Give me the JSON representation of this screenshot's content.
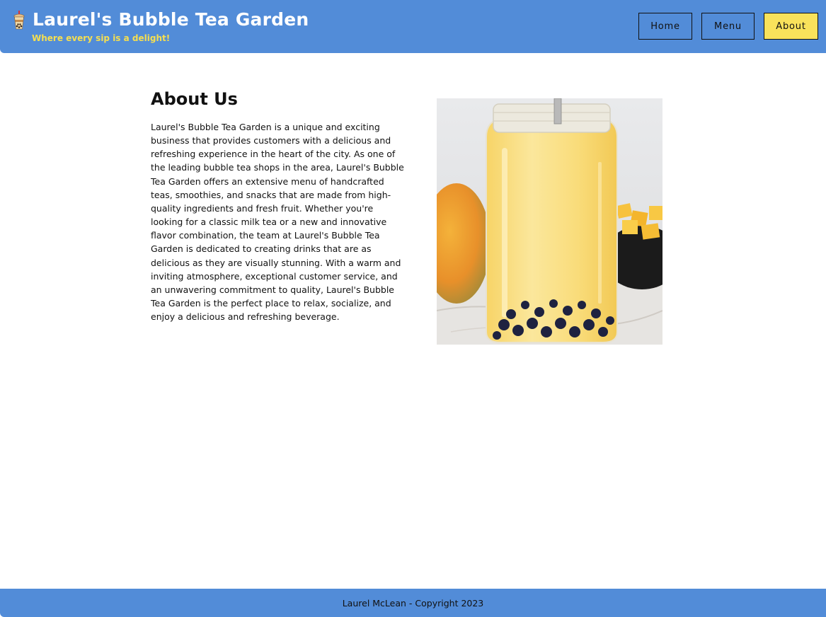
{
  "header": {
    "title": "Laurel's Bubble Tea Garden",
    "tagline": "Where every sip is a delight!",
    "logo_icon": "bubble-tea-cup-icon"
  },
  "nav": {
    "items": [
      {
        "label": "Home"
      },
      {
        "label": "Menu"
      },
      {
        "label": "About",
        "active": true
      }
    ]
  },
  "about": {
    "heading": "About Us",
    "body": "Laurel's Bubble Tea Garden is a unique and exciting business that provides customers with a delicious and refreshing experience in the heart of the city. As one of the leading bubble tea shops in the area, Laurel's Bubble Tea Garden offers an extensive menu of handcrafted teas, smoothies, and snacks that are made from high-quality ingredients and fresh fruit. Whether you're looking for a classic milk tea or a new and innovative flavor combination, the team at Laurel's Bubble Tea Garden is dedicated to creating drinks that are as delicious as they are visually stunning. With a warm and inviting atmosphere, exceptional customer service, and an unwavering commitment to quality, Laurel's Bubble Tea Garden is the perfect place to relax, socialize, and enjoy a delicious and refreshing beverage.",
    "image": "mango-bubble-tea-jar-photo"
  },
  "footer": {
    "text": "Laurel McLean - Copyright 2023"
  },
  "colors": {
    "header_bg": "#528cd8",
    "tagline": "#f6df4f",
    "active_nav": "#f9e25b"
  }
}
